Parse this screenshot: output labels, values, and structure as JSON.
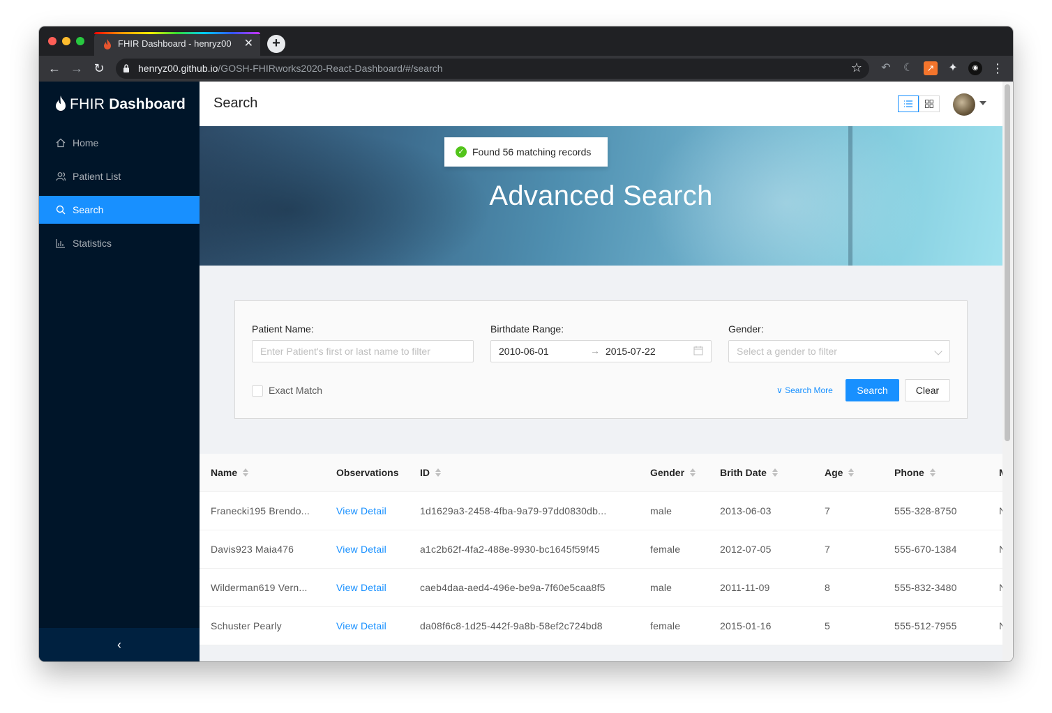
{
  "browser": {
    "tab_title": "FHIR Dashboard - henryz00",
    "tab_close": "✕",
    "new_tab": "+",
    "url_host": "henryz00.github.io",
    "url_path": "/GOSH-FHIRworks2020-React-Dashboard/#/search"
  },
  "sidebar": {
    "logo_fhir": "FHIR",
    "logo_dashboard": "Dashboard",
    "items": [
      {
        "label": "Home",
        "icon": "home-icon"
      },
      {
        "label": "Patient List",
        "icon": "team-icon"
      },
      {
        "label": "Search",
        "icon": "search-icon",
        "active": true
      },
      {
        "label": "Statistics",
        "icon": "bar-chart-icon"
      }
    ],
    "collapse_glyph": "‹"
  },
  "header": {
    "title": "Search"
  },
  "toast": {
    "message": "Found 56 matching records"
  },
  "hero": {
    "title": "Advanced Search"
  },
  "search_form": {
    "name_label": "Patient Name",
    "name_placeholder": "Enter Patient's first or last name to filter",
    "birthdate_label": "Birthdate Range",
    "birthdate_start": "2010-06-01",
    "birthdate_end": "2015-07-22",
    "gender_label": "Gender",
    "gender_placeholder": "Select a gender to filter",
    "exact_match_label": "Exact Match",
    "search_more_label": "Search More",
    "search_button": "Search",
    "clear_button": "Clear"
  },
  "table": {
    "columns": [
      "Name",
      "Observations",
      "ID",
      "Gender",
      "Brith Date",
      "Age",
      "Phone",
      "M"
    ],
    "rows": [
      {
        "name": "Franecki195 Brendo...",
        "observations": "View Detail",
        "id": "1d1629a3-2458-4fba-9a79-97dd0830db...",
        "gender": "male",
        "birth_date": "2013-06-03",
        "age": "7",
        "phone": "555-328-8750",
        "extra": "N"
      },
      {
        "name": "Davis923 Maia476",
        "observations": "View Detail",
        "id": "a1c2b62f-4fa2-488e-9930-bc1645f59f45",
        "gender": "female",
        "birth_date": "2012-07-05",
        "age": "7",
        "phone": "555-670-1384",
        "extra": "N"
      },
      {
        "name": "Wilderman619 Vern...",
        "observations": "View Detail",
        "id": "caeb4daa-aed4-496e-be9a-7f60e5caa8f5",
        "gender": "male",
        "birth_date": "2011-11-09",
        "age": "8",
        "phone": "555-832-3480",
        "extra": "N"
      },
      {
        "name": "Schuster Pearly",
        "observations": "View Detail",
        "id": "da08f6c8-1d25-442f-9a8b-58ef2c724bd8",
        "gender": "female",
        "birth_date": "2015-01-16",
        "age": "5",
        "phone": "555-512-7955",
        "extra": "N"
      }
    ]
  },
  "colors": {
    "primary": "#1890ff",
    "sider": "#001529",
    "success": "#52c41a"
  }
}
